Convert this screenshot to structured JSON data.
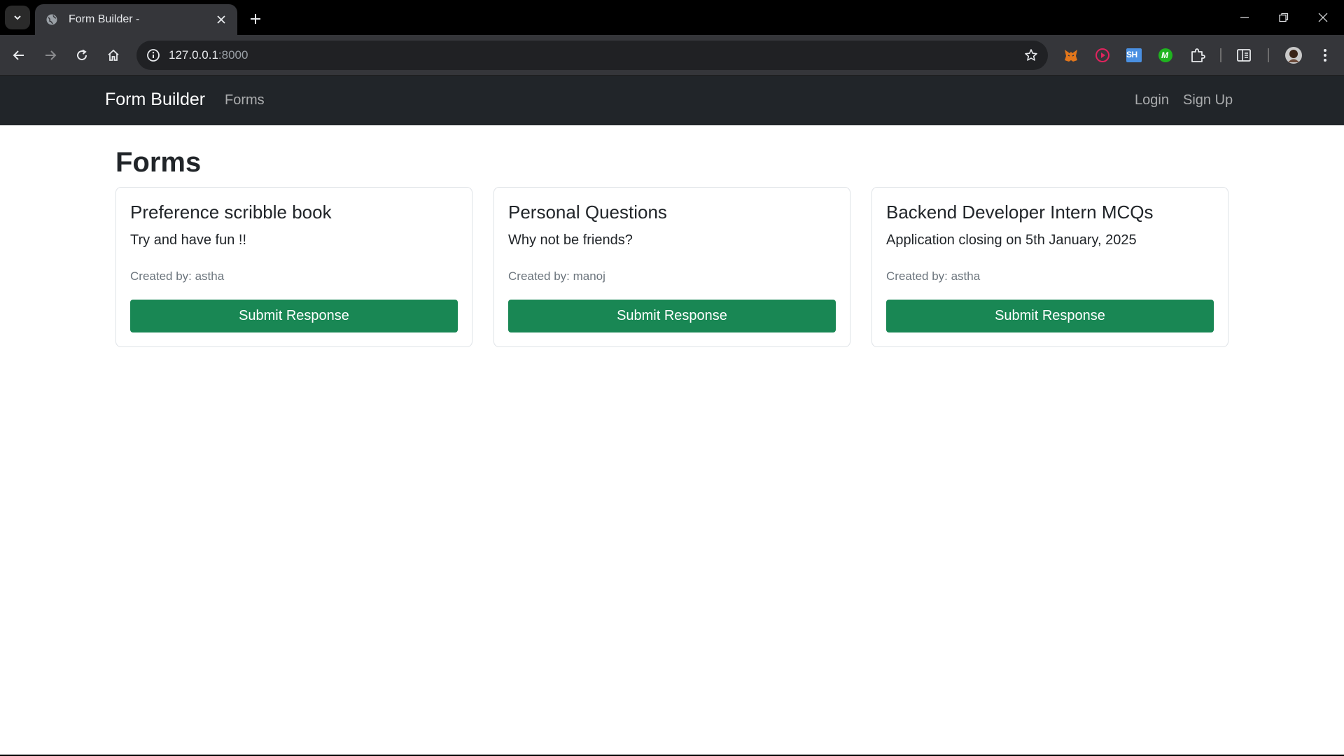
{
  "browser": {
    "tab_title": "Form Builder -",
    "url_host": "127.0.0.1",
    "url_port": ":8000",
    "extensions": [
      "metamask-icon",
      "record-icon",
      "sh-extension-icon",
      "m-extension-icon",
      "puzzle-icon"
    ],
    "sh_label": "SH",
    "m_label": "M"
  },
  "navbar": {
    "brand": "Form Builder",
    "link_forms": "Forms",
    "link_login": "Login",
    "link_signup": "Sign Up"
  },
  "page": {
    "title": "Forms"
  },
  "cards": [
    {
      "title": "Preference scribble book",
      "description": "Try and have fun !!",
      "created_by": "Created by: astha",
      "button": "Submit Response"
    },
    {
      "title": "Personal Questions",
      "description": "Why not be friends?",
      "created_by": "Created by: manoj",
      "button": "Submit Response"
    },
    {
      "title": "Backend Developer Intern MCQs",
      "description": "Application closing on 5th January, 2025",
      "created_by": "Created by: astha",
      "button": "Submit Response"
    }
  ],
  "colors": {
    "navbar_bg": "#212529",
    "button_green": "#198754",
    "chrome_bg": "#35363a"
  }
}
